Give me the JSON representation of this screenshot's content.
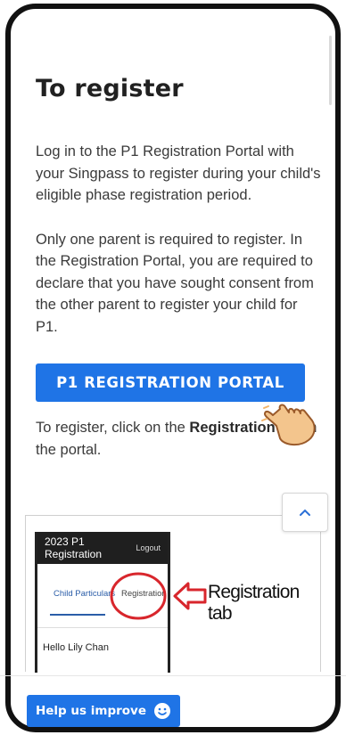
{
  "page": {
    "title": "To register",
    "paragraph1": "Log in to the P1 Registration Portal with your Singpass to register during your child's eligible phase registration period.",
    "paragraph2": "Only one parent is required to register. In the Registration Portal, you are required to declare that you have sought consent from the other parent to register your child for P1.",
    "instruction_prefix": "To register, click on the ",
    "instruction_bold": "Registration tab",
    "instruction_suffix": " in the portal."
  },
  "portal_button": {
    "label": "P1 REGISTRATION PORTAL"
  },
  "screenshot_image": {
    "header_title": "2023 P1 Registration",
    "logout": "Logout",
    "tab_child": "Child Particulars",
    "tab_registration": "Registration",
    "greeting": "Hello Lily Chan",
    "callout": "Registration tab"
  },
  "help_button": {
    "label": "Help us improve"
  },
  "icons": {
    "hand": "pointing-hand-icon",
    "up": "chevron-up-icon",
    "smile": "smiley-icon",
    "arrow": "left-arrow-icon"
  },
  "colors": {
    "primary": "#1f74e6",
    "title": "#212121",
    "text": "#3a3a3a",
    "highlight_circle": "#d8262c",
    "hand_fill": "#f3c58d"
  }
}
